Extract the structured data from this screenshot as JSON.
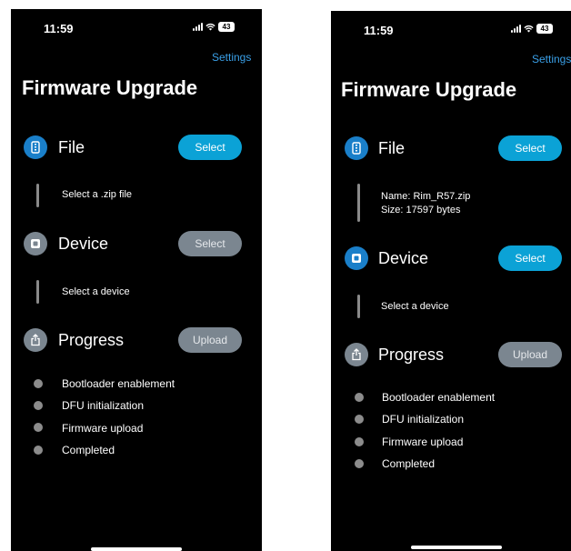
{
  "left": {
    "status": {
      "time": "11:59",
      "battery": "43"
    },
    "settings": "Settings",
    "title": "Firmware Upgrade",
    "file": {
      "label": "File",
      "button": "Select",
      "info": "Select a .zip file"
    },
    "device": {
      "label": "Device",
      "button": "Select",
      "info": "Select a device"
    },
    "progress": {
      "label": "Progress",
      "button": "Upload",
      "steps": [
        "Bootloader enablement",
        "DFU initialization",
        "Firmware upload",
        "Completed"
      ]
    }
  },
  "right": {
    "status": {
      "time": "11:59",
      "battery": "43"
    },
    "settings": "Settings",
    "title": "Firmware Upgrade",
    "file": {
      "label": "File",
      "button": "Select",
      "name": "Name: Rim_R57.zip",
      "size": "Size: 17597 bytes"
    },
    "device": {
      "label": "Device",
      "button": "Select",
      "info": "Select a device"
    },
    "progress": {
      "label": "Progress",
      "button": "Upload",
      "steps": [
        "Bootloader enablement",
        "DFU initialization",
        "Firmware upload",
        "Completed"
      ]
    }
  },
  "icons": {
    "file": "file-icon",
    "device": "device-icon",
    "progress": "share-upload-icon",
    "signal": "cellular-signal-icon",
    "wifi": "wifi-icon",
    "battery": "battery-icon"
  },
  "colors": {
    "background": "#000000",
    "accent_link": "#3aa0e8",
    "button_active": "#0ba2d6",
    "icon_active": "#1a7fc9",
    "inactive": "#7b8690",
    "step_dot": "#8c8c8c"
  }
}
